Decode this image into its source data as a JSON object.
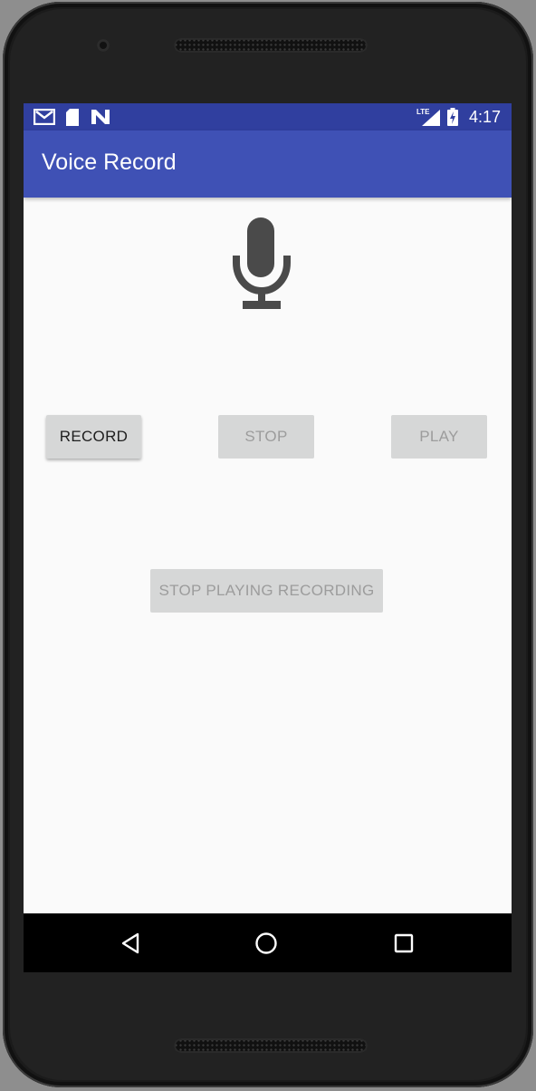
{
  "status_bar": {
    "icons": [
      "gmail-icon",
      "sd-card-icon",
      "n-icon",
      "lte-signal-icon",
      "battery-charging-icon"
    ],
    "network": "LTE",
    "time": "4:17"
  },
  "app_bar": {
    "title": "Voice Record"
  },
  "main": {
    "mic_icon": "microphone-icon",
    "buttons": {
      "record": "RECORD",
      "stop": "STOP",
      "play": "PLAY",
      "stop_playing": "STOP PLAYING RECORDING"
    }
  },
  "nav_bar": {
    "icons": [
      "back-icon",
      "home-icon",
      "recents-icon"
    ]
  },
  "colors": {
    "status_bar": "#303f9f",
    "app_bar": "#3f51b5",
    "background": "#fafafa",
    "mic": "#4a4a4a",
    "button": "#d6d7d7"
  }
}
